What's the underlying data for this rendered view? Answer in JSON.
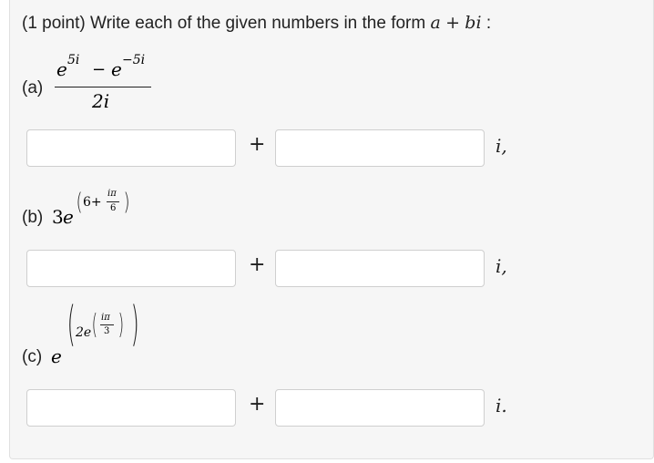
{
  "problem": {
    "prompt_prefix": "(1 point) Write each of the given numbers in the form",
    "form_a": "a",
    "form_plus": "+",
    "form_bi": "bi",
    "form_colon": ":"
  },
  "parts": [
    {
      "label": "(a)",
      "expr": {
        "num_e1": "e",
        "num_exp1": "5i",
        "num_minus": "−",
        "num_e2": "e",
        "num_exp2": "−5i",
        "den": "2i"
      },
      "real_value": "",
      "imag_value": "",
      "plus": "+",
      "suffix": "i,"
    },
    {
      "label": "(b)",
      "expr": {
        "coef": "3",
        "base": "e",
        "six_plus": "6+",
        "frac_num": "iπ",
        "frac_den": "6"
      },
      "real_value": "",
      "imag_value": "",
      "plus": "+",
      "suffix": "i,"
    },
    {
      "label": "(c)",
      "expr": {
        "base": "e",
        "two_e": "2e",
        "frac_num": "iπ",
        "frac_den": "3"
      },
      "real_value": "",
      "imag_value": "",
      "plus": "+",
      "suffix": "i."
    }
  ]
}
